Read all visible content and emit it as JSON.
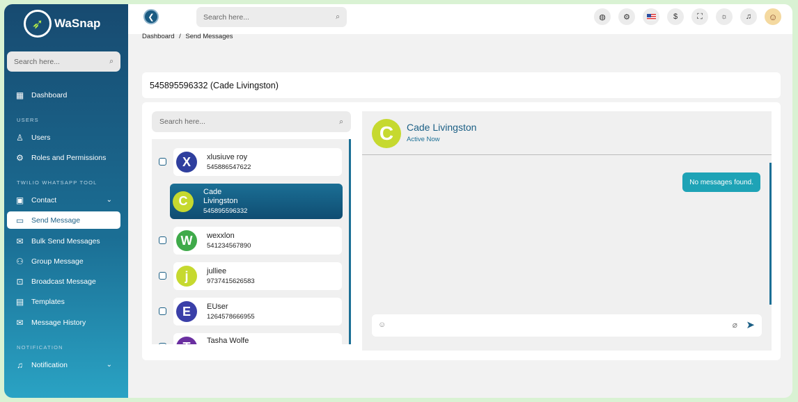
{
  "brand": {
    "name": "WaSnap"
  },
  "sidebar": {
    "search_placeholder": "Search here...",
    "items": [
      {
        "label": "Dashboard"
      },
      {
        "section": "USERS"
      },
      {
        "label": "Users"
      },
      {
        "label": "Roles and Permissions"
      },
      {
        "section": "TWILIO WHATSAPP TOOL"
      },
      {
        "label": "Contact"
      },
      {
        "label": "Send Message"
      },
      {
        "label": "Bulk Send Messages"
      },
      {
        "label": "Group Message"
      },
      {
        "label": "Broadcast Message"
      },
      {
        "label": "Templates"
      },
      {
        "label": "Message History"
      },
      {
        "section": "NOTIFICATION"
      },
      {
        "label": "Notification"
      }
    ],
    "active_color": "#ffffff"
  },
  "topbar": {
    "search_placeholder": "Search here...",
    "currency_symbol": "$",
    "icons": [
      "globe-icon",
      "api-icon",
      "us-flag-icon",
      "currency-icon",
      "fullscreen-icon",
      "sun-icon",
      "bell-icon",
      "user-avatar"
    ]
  },
  "breadcrumb": {
    "root": "Dashboard",
    "separator": "/",
    "current": "Send Messages"
  },
  "conversation": {
    "title": "545895596332 (Cade Livingston)"
  },
  "contacts": {
    "search_placeholder": "Search here...",
    "list": [
      {
        "initial": "X",
        "name": "xlusiuve roy",
        "phone": "545886547622",
        "color": "#2f3f9e"
      },
      {
        "initial": "C",
        "name_line1": "Cade",
        "name_line2": "Livingston",
        "phone": "545895596332",
        "color": "#c6d92f",
        "selected": true
      },
      {
        "initial": "W",
        "name": "wexxlon",
        "phone": "541234567890",
        "color": "#3faa4a"
      },
      {
        "initial": "j",
        "name": "julliee",
        "phone": "9737415626583",
        "color": "#c6d92f"
      },
      {
        "initial": "E",
        "name": "EUser",
        "phone": "1264578666955",
        "color": "#3a3fa8"
      },
      {
        "initial": "T",
        "name": "Tasha Wolfe",
        "phone": "",
        "color": "#6a2fa0"
      }
    ]
  },
  "chat": {
    "initial": "C",
    "name": "Cade Livingston",
    "status": "Active Now",
    "empty_text": "No messages found."
  }
}
